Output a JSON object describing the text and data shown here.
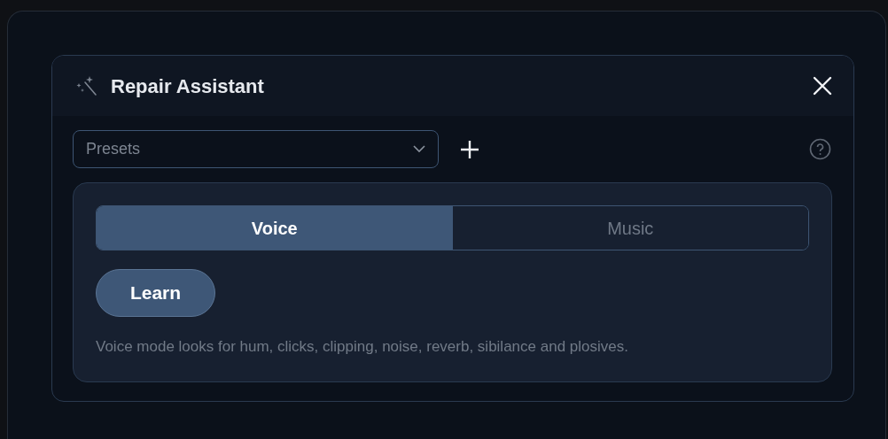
{
  "dialog": {
    "title": "Repair Assistant"
  },
  "presets": {
    "placeholder": "Presets"
  },
  "modes": [
    {
      "label": "Voice",
      "selected": true
    },
    {
      "label": "Music",
      "selected": false
    }
  ],
  "learn_button": "Learn",
  "description": "Voice mode looks for hum, clicks, clipping, noise, reverb, sibilance and plosives."
}
